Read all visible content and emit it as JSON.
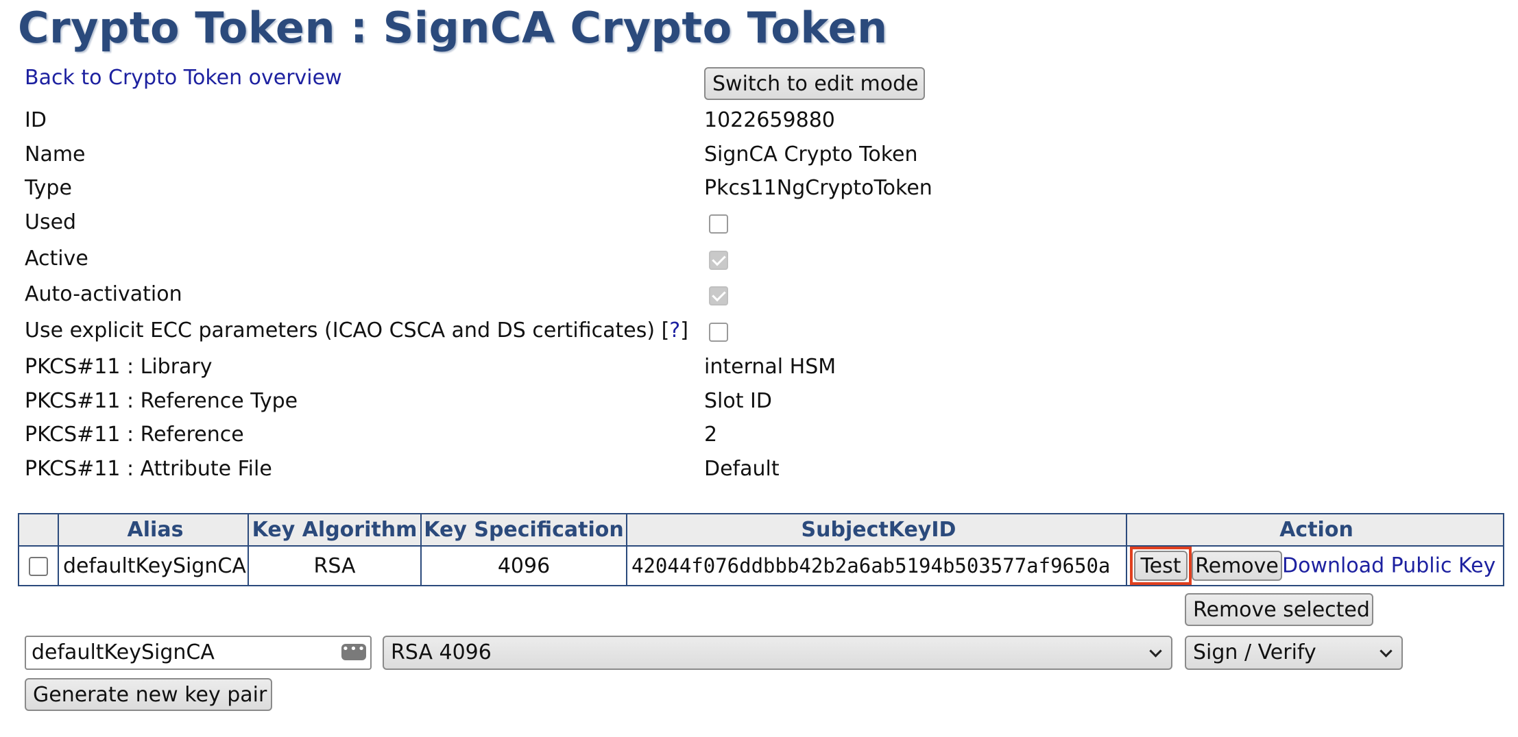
{
  "page": {
    "title": "Crypto Token : SignCA Crypto Token",
    "back_link": "Back to Crypto Token overview",
    "edit_button": "Switch to edit mode"
  },
  "properties": {
    "id": {
      "label": "ID",
      "value": "1022659880"
    },
    "name": {
      "label": "Name",
      "value": "SignCA Crypto Token"
    },
    "type": {
      "label": "Type",
      "value": "Pkcs11NgCryptoToken"
    },
    "used": {
      "label": "Used",
      "checked": false
    },
    "active": {
      "label": "Active",
      "checked": true
    },
    "auto_activation": {
      "label": "Auto-activation",
      "checked": true
    },
    "explicit_ecc": {
      "label": "Use explicit ECC parameters (ICAO CSCA and DS certificates) [",
      "help": "?",
      "label_end": "]",
      "checked": false
    },
    "library": {
      "label": "PKCS#11 : Library",
      "value": "internal HSM"
    },
    "reference_type": {
      "label": "PKCS#11 : Reference Type",
      "value": "Slot ID"
    },
    "reference": {
      "label": "PKCS#11 : Reference",
      "value": "2"
    },
    "attribute_file": {
      "label": "PKCS#11 : Attribute File",
      "value": "Default"
    }
  },
  "keys_table": {
    "headers": [
      "",
      "Alias",
      "Key Algorithm",
      "Key Specification",
      "SubjectKeyID",
      "Action"
    ],
    "rows": [
      {
        "alias": "defaultKeySignCA",
        "algorithm": "RSA",
        "specification": "4096",
        "subject_key_id": "42044f076ddbbb42b2a6ab5194b503577af9650a",
        "test_label": "Test",
        "remove_label": "Remove",
        "download_label": "Download Public Key"
      }
    ],
    "remove_selected": "Remove selected"
  },
  "generate": {
    "alias_value": "defaultKeySignCA",
    "algorithm_selected": "RSA 4096",
    "usage_selected": "Sign / Verify",
    "button": "Generate new key pair"
  },
  "colors": {
    "title": "#2b4a7c",
    "link": "#1d21a0",
    "highlight": "#e0401f"
  }
}
